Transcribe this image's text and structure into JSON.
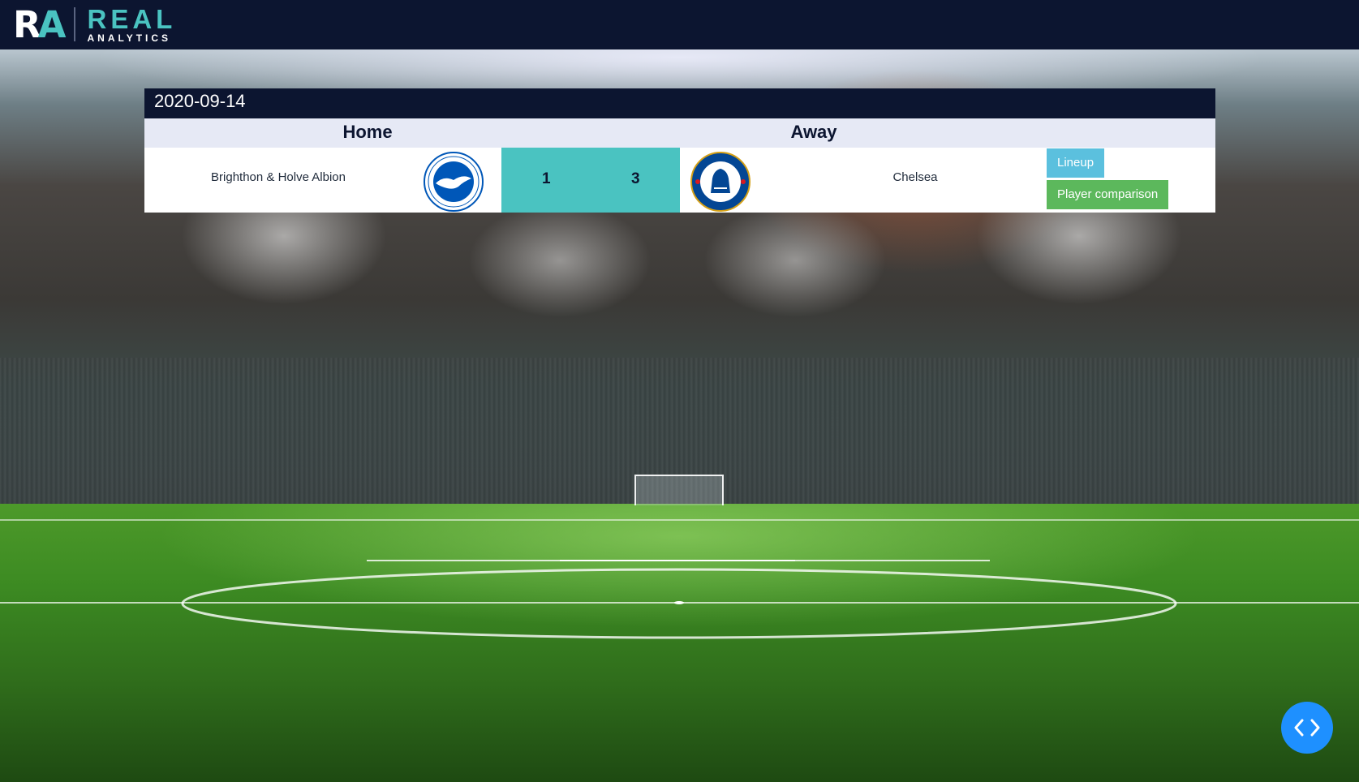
{
  "brand": {
    "mark_r": "R",
    "mark_a": "A",
    "name_top": "REAL",
    "name_bottom": "ANALYTICS",
    "accent_color": "#4ac3c1",
    "nav_color": "#0c1530"
  },
  "match": {
    "date": "2020-09-14",
    "home_header": "Home",
    "away_header": "Away",
    "home_team": "Brighthon & Holve Albion",
    "away_team": "Chelsea",
    "home_score": "1",
    "away_score": "3",
    "home_badge_icon": "brighton-badge-icon",
    "away_badge_icon": "chelsea-badge-icon"
  },
  "actions": {
    "lineup_label": "Lineup",
    "compare_label": "Player comparison",
    "lineup_color": "#5bc0de",
    "compare_color": "#5cb85c"
  },
  "fab": {
    "icon": "code-icon",
    "color": "#1e90ff"
  }
}
